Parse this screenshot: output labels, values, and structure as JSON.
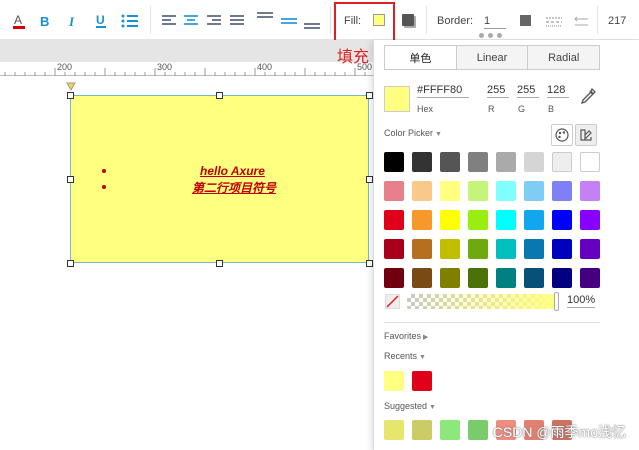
{
  "toolbar": {
    "fill_label": "Fill:",
    "border_label": "Border:",
    "border_width": "1",
    "extra_value": "217",
    "fill_color": "#FFFF80"
  },
  "ruler": {
    "labels": [
      "200",
      "300",
      "400",
      "500"
    ]
  },
  "shape": {
    "line1": "hello  Axure",
    "line2": "第二行项目符号",
    "fill": "#FFFF80",
    "text_color": "#C00000"
  },
  "annotation": "填充",
  "panel": {
    "tabs": [
      "单色",
      "Linear",
      "Radial"
    ],
    "hex_value": "#FFFF80",
    "hex_label": "Hex",
    "r_value": "255",
    "g_value": "255",
    "b_value": "128",
    "r_label": "R",
    "g_label": "G",
    "b_label": "B",
    "color_picker_label": "Color Picker",
    "alpha_value": "100%",
    "favorites_label": "Favorites",
    "recents_label": "Recents",
    "suggested_label": "Suggested",
    "palette": [
      [
        "#000000",
        "#333333",
        "#555555",
        "#808080",
        "#AAAAAA",
        "#D5D5D5",
        "#EEEEEE",
        "#FFFFFF"
      ],
      [
        "#E8808C",
        "#F9C98A",
        "#FFFF80",
        "#C4F47A",
        "#80FFFF",
        "#7FCDF5",
        "#8080F5",
        "#C480F5"
      ],
      [
        "#E0001A",
        "#F6992A",
        "#FFFF00",
        "#99EE11",
        "#00FFFF",
        "#11A6EE",
        "#0000FF",
        "#8800FF"
      ],
      [
        "#A8001A",
        "#B56F1F",
        "#BFBF00",
        "#6EAA0E",
        "#00BFBF",
        "#0A78B0",
        "#0000BF",
        "#6600BF"
      ],
      [
        "#70000F",
        "#7A4A14",
        "#808000",
        "#4A7209",
        "#008080",
        "#075078",
        "#000080",
        "#440080"
      ]
    ],
    "recents": [
      "#FFFF80",
      "#E0001A"
    ],
    "suggested": [
      "#E6E66E",
      "#CCCC66",
      "#8CE87A",
      "#7ACC6A",
      "#F08C80",
      "#E08070",
      "#D07060"
    ]
  },
  "watermark": "CSDN @雨季mo浅忆"
}
